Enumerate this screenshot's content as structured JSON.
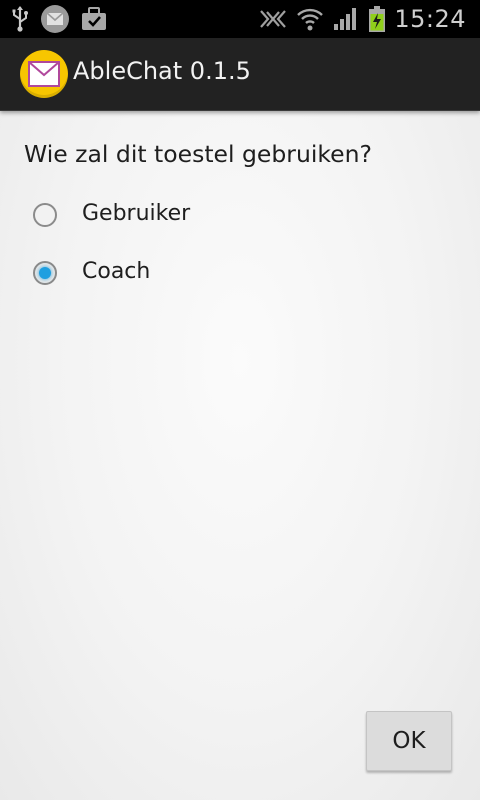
{
  "status_bar": {
    "time": "15:24",
    "left_icons": [
      "usb-icon",
      "mail-notification-icon",
      "briefcase-icon"
    ],
    "right_icons": [
      "nfc-icon",
      "wifi-icon",
      "signal-icon",
      "battery-charging-icon"
    ]
  },
  "action_bar": {
    "icon": "envelope-icon",
    "title": "AbleChat 0.1.5",
    "icon_color": "#f7c600"
  },
  "main": {
    "question": "Wie zal dit toestel gebruiken?",
    "options": [
      {
        "label": "Gebruiker",
        "selected": false
      },
      {
        "label": "Coach",
        "selected": true
      }
    ],
    "ok_label": "OK"
  },
  "colors": {
    "accent": "#1f9fe0",
    "action_bar": "#222222",
    "status_bar": "#000000"
  }
}
